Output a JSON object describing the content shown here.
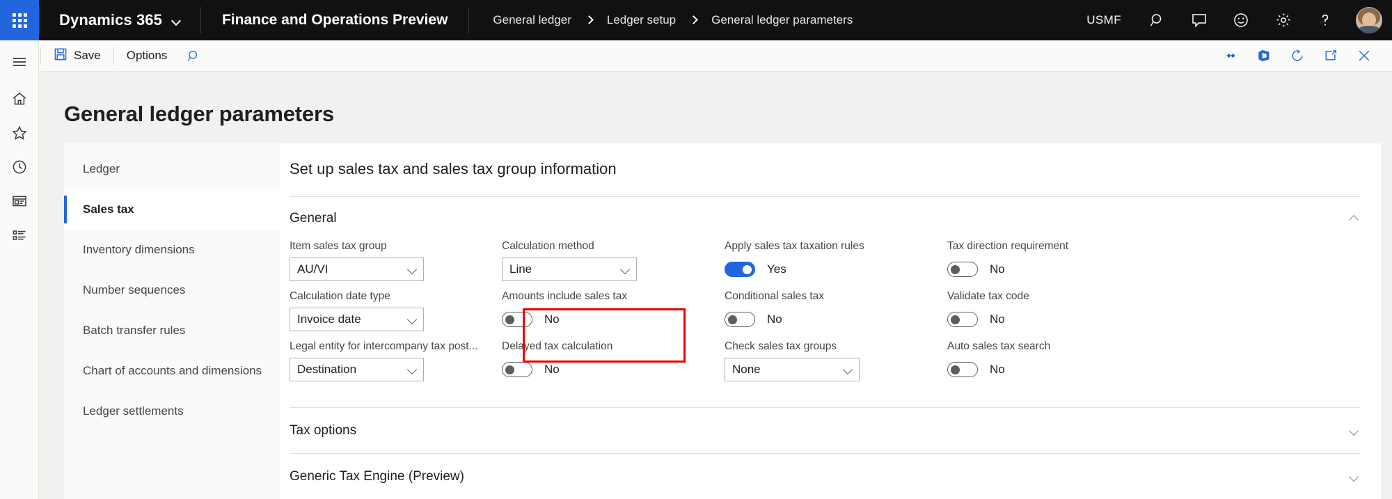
{
  "topbar": {
    "waffle_icon": "waffle-grid-icon",
    "brand": "Dynamics 365",
    "brand_chevron_icon": "chevron-down-icon",
    "app_name": "Finance and Operations Preview",
    "breadcrumb": [
      "General ledger",
      "Ledger setup",
      "General ledger parameters"
    ],
    "company": "USMF",
    "icons": [
      {
        "name": "search-icon",
        "glyph": "search"
      },
      {
        "name": "message-icon",
        "glyph": "message"
      },
      {
        "name": "feedback-smiley-icon",
        "glyph": "smiley"
      },
      {
        "name": "settings-gear-icon",
        "glyph": "gear"
      },
      {
        "name": "help-question-icon",
        "glyph": "question"
      }
    ],
    "avatar_name": "user-avatar",
    "bg_color": "#111111",
    "accent_color": "#2266dd"
  },
  "actionbar": {
    "save_label": "Save",
    "save_icon": "save-floppy-icon",
    "options_label": "Options",
    "search_icon": "search-icon",
    "right_icons": [
      {
        "name": "attach-link-icon"
      },
      {
        "name": "office-app-icon"
      },
      {
        "name": "refresh-icon"
      },
      {
        "name": "open-in-new-window-icon"
      },
      {
        "name": "close-icon"
      }
    ]
  },
  "leftrail": {
    "items": [
      {
        "name": "nav-menu-hamburger",
        "glyph": "hamburger"
      },
      {
        "name": "home-icon",
        "glyph": "home"
      },
      {
        "name": "favorites-star-icon",
        "glyph": "star"
      },
      {
        "name": "recent-clock-icon",
        "glyph": "clock"
      },
      {
        "name": "workspaces-icon",
        "glyph": "workspace"
      },
      {
        "name": "modules-list-icon",
        "glyph": "list"
      }
    ]
  },
  "page": {
    "title": "General ledger parameters",
    "tabs": [
      {
        "label": "Ledger",
        "selected": false
      },
      {
        "label": "Sales tax",
        "selected": true
      },
      {
        "label": "Inventory dimensions",
        "selected": false
      },
      {
        "label": "Number sequences",
        "selected": false
      },
      {
        "label": "Batch transfer rules",
        "selected": false
      },
      {
        "label": "Chart of accounts and dimensions",
        "selected": false
      },
      {
        "label": "Ledger settlements",
        "selected": false
      }
    ],
    "panel_heading": "Set up sales tax and sales tax group information",
    "sections": [
      {
        "title": "General",
        "expanded": true,
        "chevron": "chevron-up-icon"
      },
      {
        "title": "Tax options",
        "expanded": false,
        "chevron": "chevron-down-icon"
      },
      {
        "title": "Generic Tax Engine (Preview)",
        "expanded": false,
        "chevron": "chevron-down-icon"
      }
    ],
    "fields": {
      "col1": [
        {
          "label": "Item sales tax group",
          "type": "combo",
          "value": "AU/VI"
        },
        {
          "label": "Calculation date type",
          "type": "combo",
          "value": "Invoice date"
        },
        {
          "label": "Legal entity for intercompany tax post...",
          "type": "combo",
          "value": "Destination"
        }
      ],
      "col2": [
        {
          "label": "Calculation method",
          "type": "combo",
          "value": "Line"
        },
        {
          "label": "Amounts include sales tax",
          "type": "toggle",
          "value": "No",
          "on": false
        },
        {
          "label": "Delayed tax calculation",
          "type": "toggle",
          "value": "No",
          "on": false,
          "highlighted": true
        }
      ],
      "col3": [
        {
          "label": "Apply sales tax taxation rules",
          "type": "toggle",
          "value": "Yes",
          "on": true
        },
        {
          "label": "Conditional sales tax",
          "type": "toggle",
          "value": "No",
          "on": false
        },
        {
          "label": "Check sales tax groups",
          "type": "combo",
          "value": "None"
        }
      ],
      "col4": [
        {
          "label": "Tax direction requirement",
          "type": "toggle",
          "value": "No",
          "on": false
        },
        {
          "label": "Validate tax code",
          "type": "toggle",
          "value": "No",
          "on": false
        },
        {
          "label": "Auto sales tax search",
          "type": "toggle",
          "value": "No",
          "on": false
        }
      ]
    },
    "highlight_color": "#ee0000"
  }
}
